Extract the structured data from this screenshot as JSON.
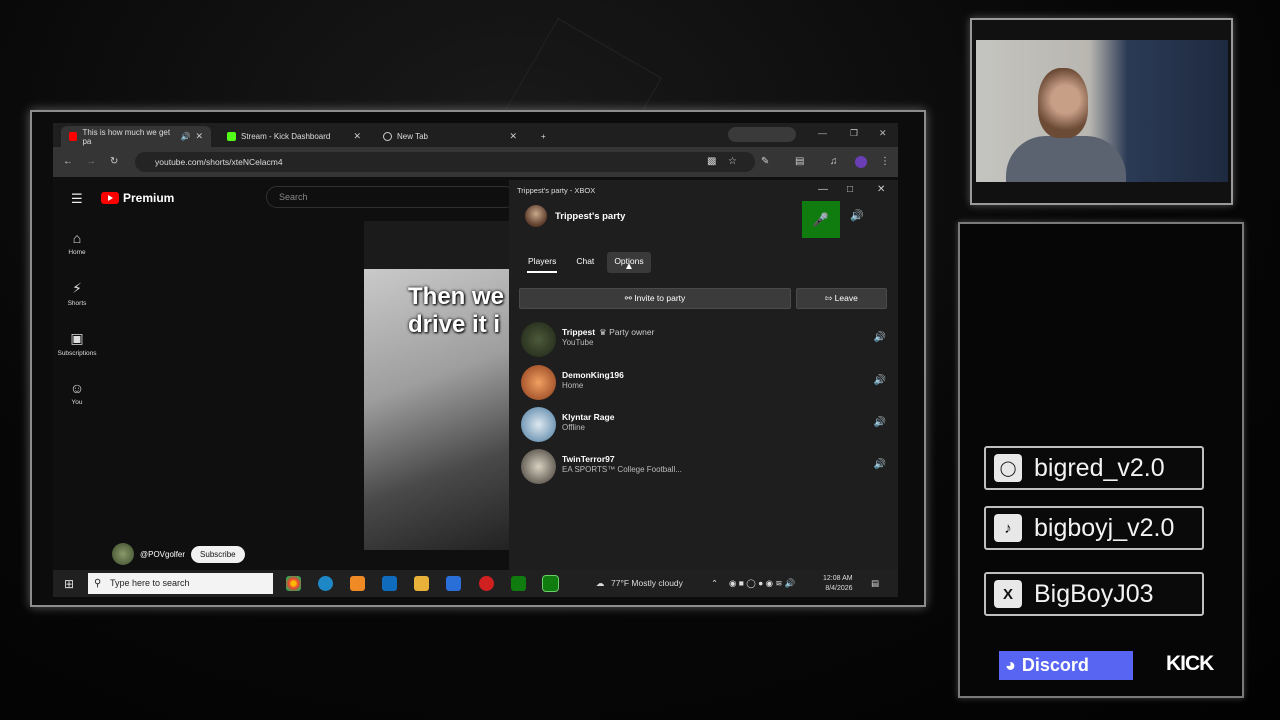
{
  "browser": {
    "tabs": [
      {
        "label": "This is how much we get pa",
        "active": true
      },
      {
        "label": "Stream - Kick Dashboard",
        "active": false
      },
      {
        "label": "New Tab",
        "active": false
      }
    ],
    "url": "youtube.com/shorts/xteNCelacm4"
  },
  "youtube": {
    "brand": "Premium",
    "search_placeholder": "Search",
    "nav": [
      {
        "label": "Home",
        "icon": "home-icon"
      },
      {
        "label": "Shorts",
        "icon": "shorts-icon"
      },
      {
        "label": "Subscriptions",
        "icon": "subscriptions-icon"
      },
      {
        "label": "You",
        "icon": "user-icon"
      }
    ],
    "video_caption_line1": "Then we",
    "video_caption_line2": "drive it i",
    "channel": "@POVgolfer",
    "subscribe": "Subscribe"
  },
  "party": {
    "window_title": "Trippest's party - XBOX",
    "name": "Trippest's party",
    "tabs": [
      "Players",
      "Chat",
      "Options"
    ],
    "invite": "Invite to party",
    "leave": "Leave",
    "members": [
      {
        "name": "Trippest",
        "tag": "Party owner",
        "status": "YouTube"
      },
      {
        "name": "DemonKing196",
        "tag": "",
        "status": "Home"
      },
      {
        "name": "Klyntar Rage",
        "tag": "",
        "status": "Offline"
      },
      {
        "name": "TwinTerror97",
        "tag": "",
        "status": "EA SPORTS™ College Football..."
      }
    ]
  },
  "taskbar": {
    "search_placeholder": "Type here to search",
    "weather": "77°F  Mostly cloudy",
    "time": "12:08 AM",
    "date": "8/4/2026"
  },
  "socials": {
    "instagram": "bigred_v2.0",
    "tiktok": "bigboyj_v2.0",
    "x": "BigBoyJ03",
    "discord": "Discord",
    "kick": "KICK"
  }
}
